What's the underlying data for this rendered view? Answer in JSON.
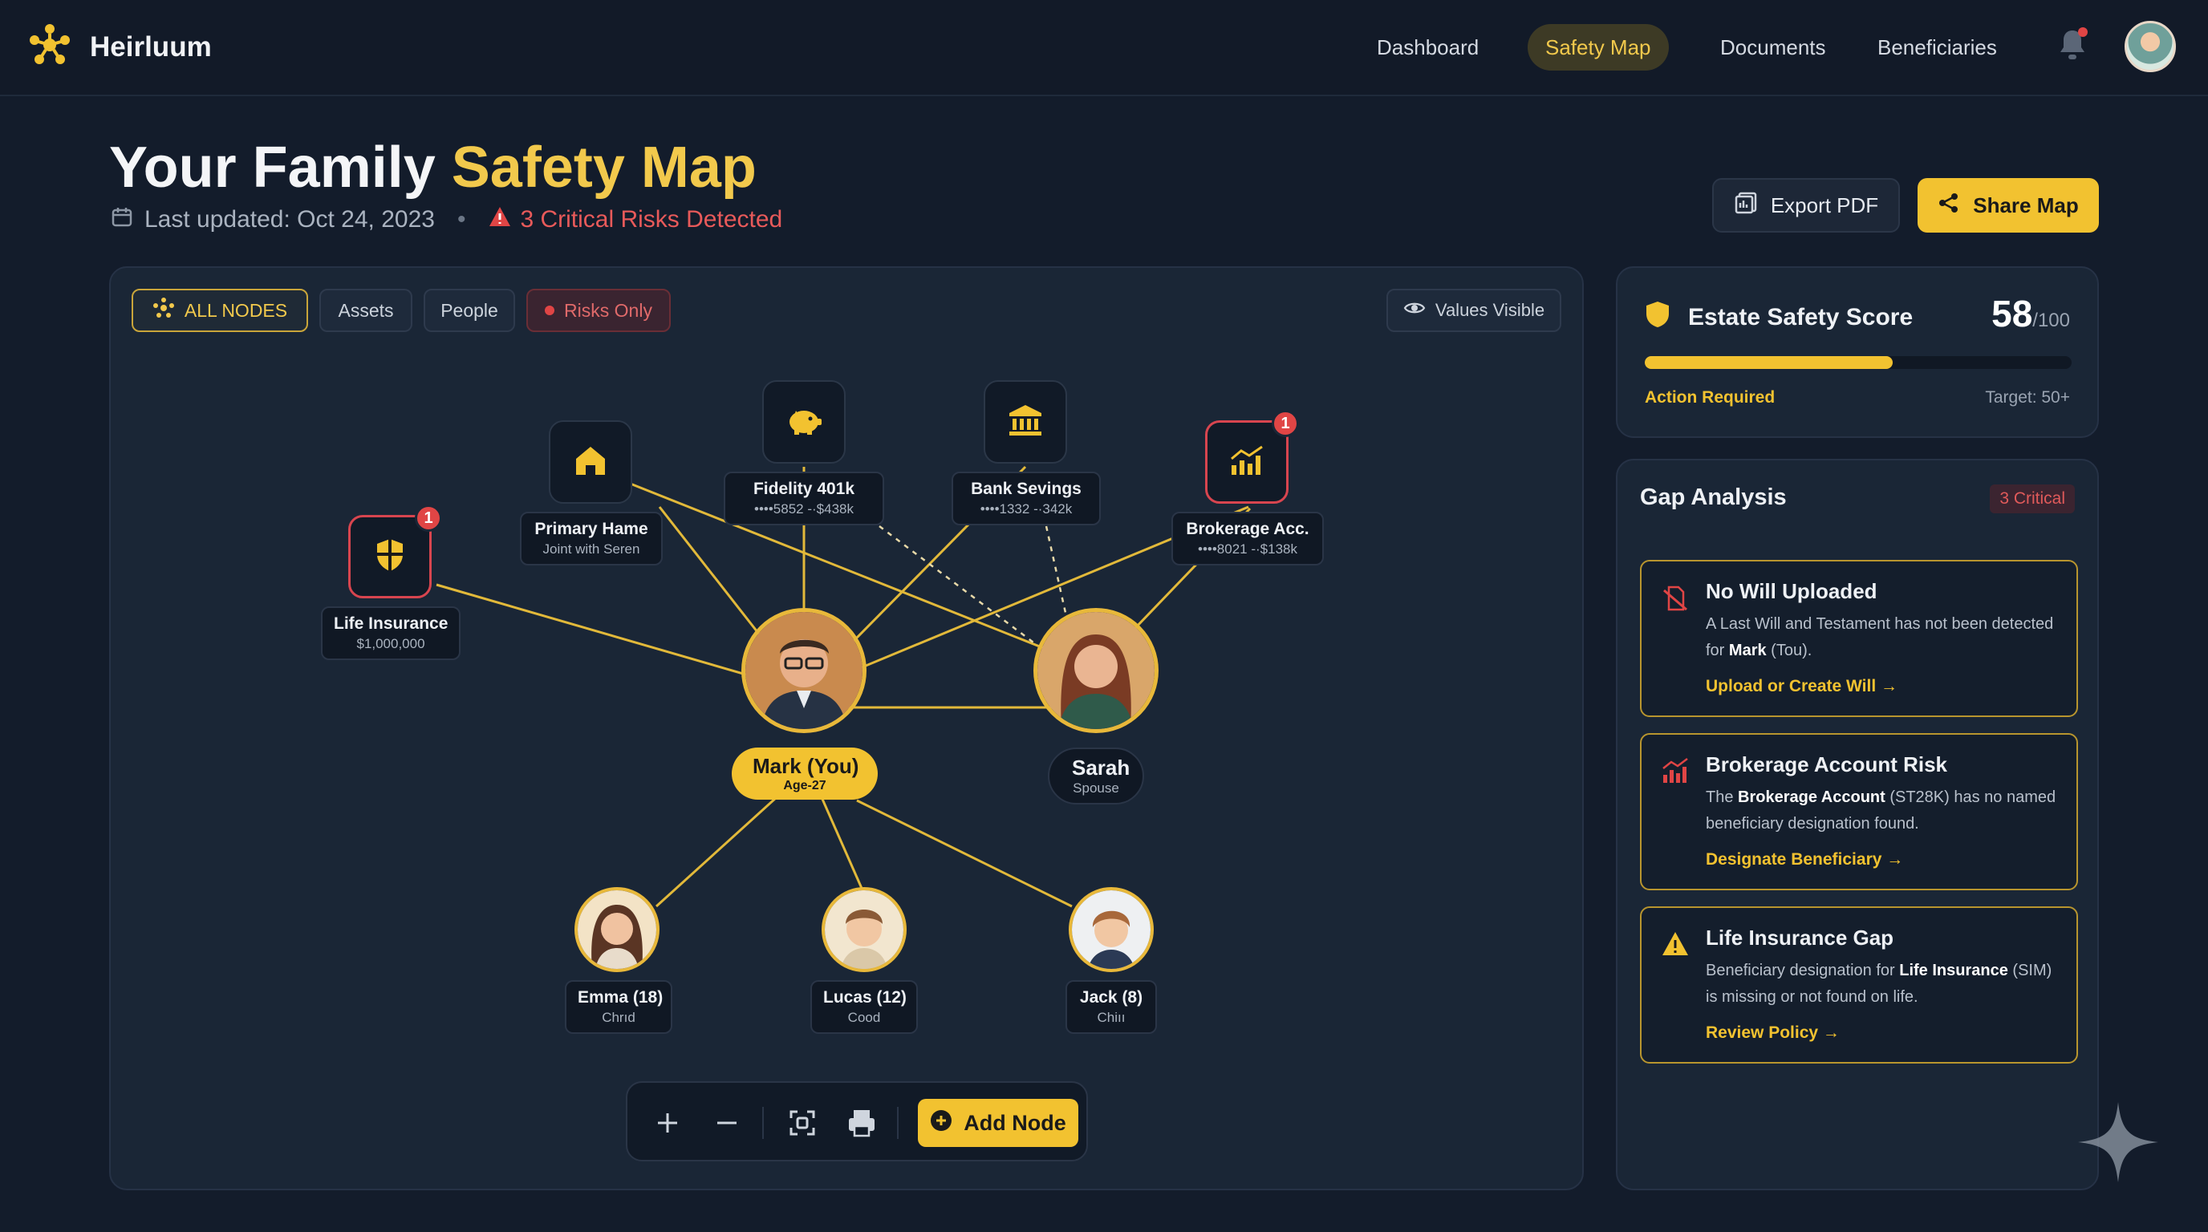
{
  "app": {
    "name": "Heirluum"
  },
  "nav": {
    "items": [
      "Dashboard",
      "Safety Map",
      "Documents",
      "Beneficiaries"
    ],
    "active": "Safety Map"
  },
  "header": {
    "title_part1": "Your Family",
    "title_part2": "Safety Map",
    "last_updated": "Last updated: Oct 24, 2023",
    "separator": "•",
    "risks": "3 Critical Risks Detected"
  },
  "actions": {
    "export": "Export PDF",
    "share": "Share Map"
  },
  "filters": {
    "all": "ALL NODES",
    "assets": "Assets",
    "people": "People",
    "risks": "Risks Only",
    "values": "Values Visible"
  },
  "nodes": {
    "life_insurance": {
      "title": "Life Insurance",
      "sub": "$1,000,000",
      "badge": "1"
    },
    "primary_home": {
      "title": "Primary Hame",
      "sub": "Joint with Seren"
    },
    "fidelity": {
      "title": "Fidelity 401k",
      "sub": "••••5852 -·$438k"
    },
    "bank": {
      "title": "Bank Sevings",
      "sub": "••••1332 -·342k"
    },
    "brokerage": {
      "title": "Brokerage Acc.",
      "sub": "••••8021 -·$138k",
      "badge": "1"
    },
    "mark": {
      "title": "Mark (You)",
      "sub": "Age-27"
    },
    "sarah": {
      "title": "Sarah",
      "sub": "Spouse"
    },
    "emma": {
      "title": "Emma (18)",
      "sub": "Chrıd"
    },
    "lucas": {
      "title": "Lucas (12)",
      "sub": "Cood"
    },
    "jack": {
      "title": "Jack (8)",
      "sub": "Chiıı"
    }
  },
  "toolbar": {
    "add_node": "Add Node"
  },
  "score": {
    "title": "Estate Safety Score",
    "value": "58",
    "max": "/100",
    "progress": 0.58,
    "status": "Action Required",
    "target": "Target: 50+"
  },
  "gap": {
    "title": "Gap Analysis",
    "badge": "3 Critical",
    "items": [
      {
        "title": "No Will Uploaded",
        "desc_a": "A Last Will and Testament has not been detected for ",
        "bold": "Mark",
        "desc_b": " (Tou).",
        "link": "Upload or Create Will"
      },
      {
        "title": "Brokerage Account Risk",
        "desc_a": "The ",
        "bold": "Brokerage Account",
        "desc_b": " (ST28K) has no named beneficiary designation found.",
        "link": "Designate Beneficiary"
      },
      {
        "title": "Life Insurance Gap",
        "desc_a": "Beneficiary designation for ",
        "bold": "Life Insurance",
        "desc_b": " (SIM) is missing or not found on life.",
        "link": "Review Policy"
      }
    ]
  },
  "colors": {
    "accent": "#f2c230",
    "danger": "#e04545",
    "bg": "#131c2b",
    "panel": "#1a2636"
  }
}
